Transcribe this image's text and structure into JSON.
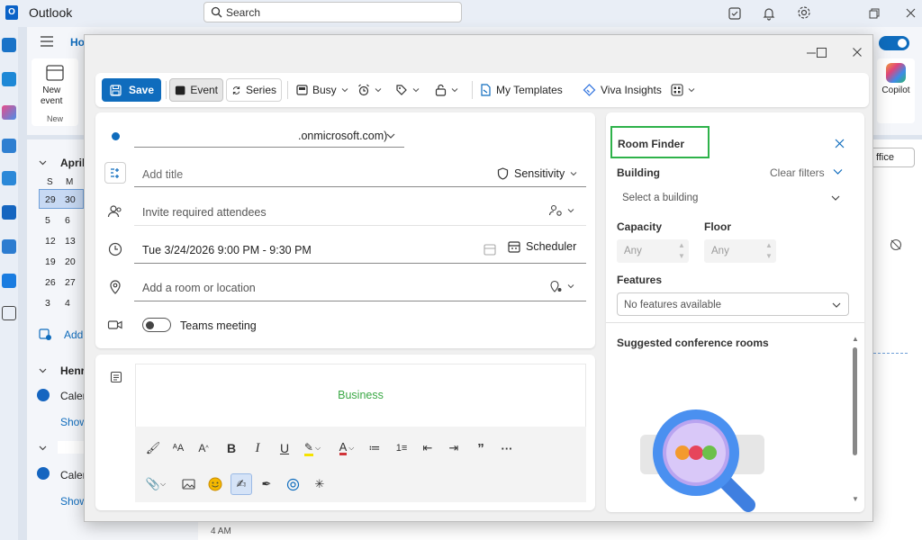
{
  "app": {
    "title": "Outlook",
    "search_placeholder": "Search"
  },
  "background": {
    "ribbon_tab": "Ho",
    "new_event_label": "New\nevent",
    "new_group": "New",
    "copilot": "Copilot",
    "month": "April",
    "weekday_headers": [
      "S",
      "M"
    ],
    "calendar_rows": [
      [
        "29",
        "30"
      ],
      [
        "5",
        "6"
      ],
      [
        "12",
        "13"
      ],
      [
        "19",
        "20"
      ],
      [
        "26",
        "27"
      ],
      [
        "3",
        "4"
      ]
    ],
    "add_calendar": "Add",
    "group1": "Henr",
    "calendar_item": "Caler",
    "show_all": "Show",
    "calendar_item2": "Caler",
    "show_all2": "Show",
    "office_btn": "ffice",
    "time_label": "4 AM"
  },
  "toolbar": {
    "save": "Save",
    "event": "Event",
    "series": "Series",
    "busy": "Busy",
    "my_templates": "My Templates",
    "viva_insights": "Viva Insights"
  },
  "form": {
    "from_account": ".onmicrosoft.com)",
    "title_placeholder": "Add title",
    "sensitivity": "Sensitivity",
    "attendees_placeholder": "Invite required attendees",
    "datetime": "Tue 3/24/2026 9:00 PM - 9:30 PM",
    "scheduler": "Scheduler",
    "location_placeholder": "Add a room or location",
    "teams_meeting": "Teams meeting"
  },
  "body": {
    "content": "Business",
    "content_color": "#3aa845"
  },
  "room_finder": {
    "title": "Room Finder",
    "building_label": "Building",
    "clear_filters": "Clear filters",
    "building_placeholder": "Select a building",
    "capacity_label": "Capacity",
    "floor_label": "Floor",
    "capacity_placeholder": "Any",
    "floor_placeholder": "Any",
    "features_label": "Features",
    "features_value": "No features available",
    "suggested_label": "Suggested conference rooms"
  },
  "colors": {
    "accent": "#0f6cbd",
    "highlight_border": "#2eb24a"
  }
}
